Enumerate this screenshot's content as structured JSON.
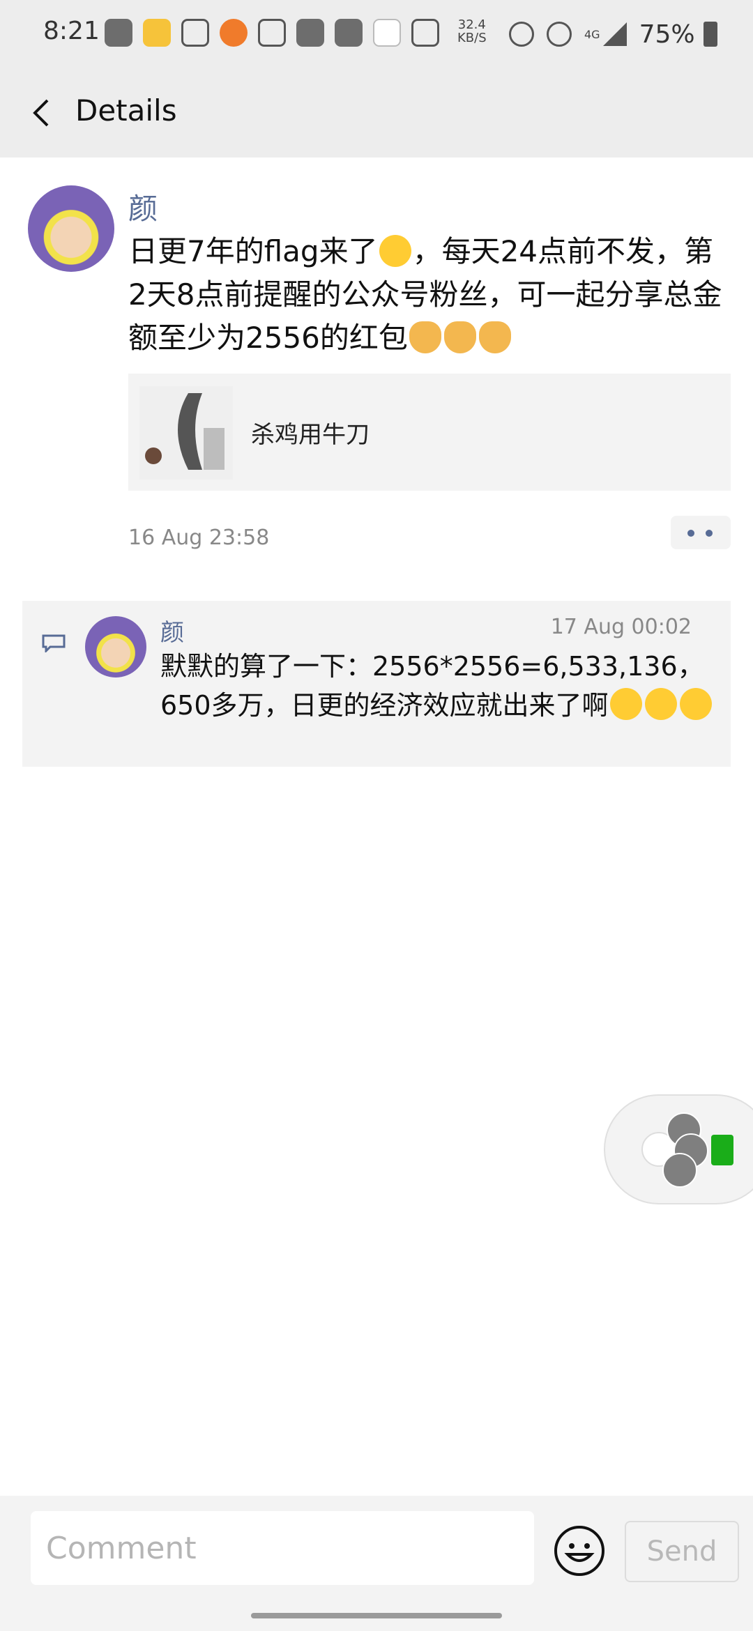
{
  "status_bar": {
    "time": "8:21",
    "net_speed_value": "32.4",
    "net_speed_unit": "KB/S",
    "network_type": "4G",
    "battery": "75%"
  },
  "header": {
    "back_icon": "chevron-left-icon",
    "title": "Details"
  },
  "post": {
    "author": "颜",
    "text_line1": "日更7年的flag来了",
    "text_line1b": "，每天24点前不发，第2天8点前提醒的公众号粉丝，可一起分享总金额至少为2556的红包",
    "emoji": {
      "smirk": "smirk-emoji-icon",
      "doge": "doge-emoji-icon"
    },
    "link_title": "杀鸡用牛刀",
    "time": "16 Aug 23:58",
    "more_icon": "more-dots-icon"
  },
  "comments": [
    {
      "author": "颜",
      "time": "17 Aug 00:02",
      "text": "默默的算了一下：2556*2556=6,533,136，650多万，日更的经济效应就出来了啊",
      "emoji": "crying-laughing-emoji-icon"
    }
  ],
  "composer": {
    "placeholder": "Comment",
    "send_label": "Send",
    "emoji_icon": "smiley-icon"
  },
  "colors": {
    "link_blue": "#576b95",
    "header_bg": "#ededed",
    "card_bg": "#f3f3f3"
  }
}
